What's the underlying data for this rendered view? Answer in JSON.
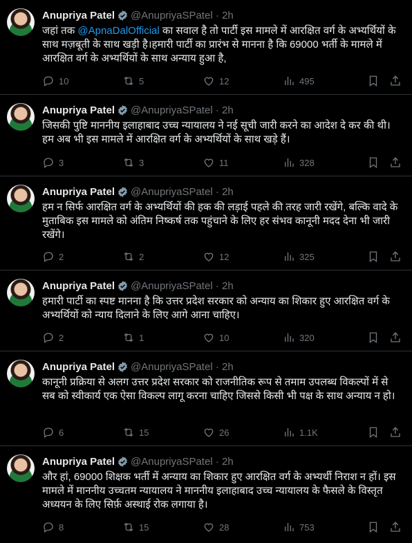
{
  "author": {
    "name": "Anupriya Patel",
    "handle": "@AnupriyaSPatel",
    "time": "2h"
  },
  "colors": {
    "background": "#000000",
    "text": "#e7e9ea",
    "muted": "#71767b",
    "accent": "#1d9bf0",
    "divider": "#2f3336"
  },
  "tweets": [
    {
      "text_before": "जहां तक ",
      "mention": "@ApnaDalOfficial",
      "text": " का सवाल है तो पार्टी इस मामले में आरक्षित वर्ग के अभ्यर्थियों के साथ मज़बूती के साथ खड़ी है।हमारी पार्टी का प्रारंभ से मानना है कि 69000 भर्ती के मामले में आरक्षित वर्ग के अभ्यर्थियों के साथ अन्याय हुआ है,",
      "replies": "10",
      "retweets": "5",
      "likes": "12",
      "views": "495"
    },
    {
      "text": "जिसकी पुष्टि माननीय इलाहाबाद उच्च न्यायालय ने नई सूची जारी करने का आदेश दे कर की थी। हम अब भी इस मामले में आरक्षित वर्ग के अभ्यर्थियों के साथ खड़े हैं।",
      "replies": "3",
      "retweets": "3",
      "likes": "11",
      "views": "328"
    },
    {
      "text": "हम न सिर्फ आरक्षित वर्ग के अभ्यर्थियों की हक की लड़ाई पहले की तरह जारी रखेंगे, बल्कि वादे के मुताबिक इस मामले को अंतिम निष्कर्ष तक पहुंचाने के लिए हर संभव कानूनी मदद देना भी जारी रखेंगे।",
      "replies": "2",
      "retweets": "2",
      "likes": "12",
      "views": "325"
    },
    {
      "text": "हमारी पार्टी का स्पष्ट मानना है कि उत्तर प्रदेश सरकार को अन्याय का शिकार हुए आरक्षित वर्ग के अभ्यर्थियों को न्याय दिलाने के लिए आगे आना चाहिए।",
      "replies": "2",
      "retweets": "1",
      "likes": "10",
      "views": "320"
    },
    {
      "text": "कानूनी प्रक्रिया से अलग उत्तर प्रदेश सरकार को राजनीतिक रूप से तमाम उपलब्ध विकल्पों में से सब को स्वीकार्य एक ऐसा विकल्प लागू करना चाहिए जिससे किसी भी पक्ष के साथ अन्याय न हो।",
      "replies": "6",
      "retweets": "15",
      "likes": "26",
      "views": "1.1K"
    },
    {
      "text": "और हां, 69000 शिक्षक भर्ती में अन्याय का शिकार हुए आरक्षित वर्ग के अभ्यर्थी निराश न हों। इस मामले में माननीय उच्चतम न्यायालय ने माननीय इलाहाबाद उच्च न्यायालय के फैसले के विस्तृत अध्ययन के लिए सिर्फ़ अस्थाई रोक लगाया है।",
      "replies": "8",
      "retweets": "15",
      "likes": "28",
      "views": "753"
    }
  ]
}
